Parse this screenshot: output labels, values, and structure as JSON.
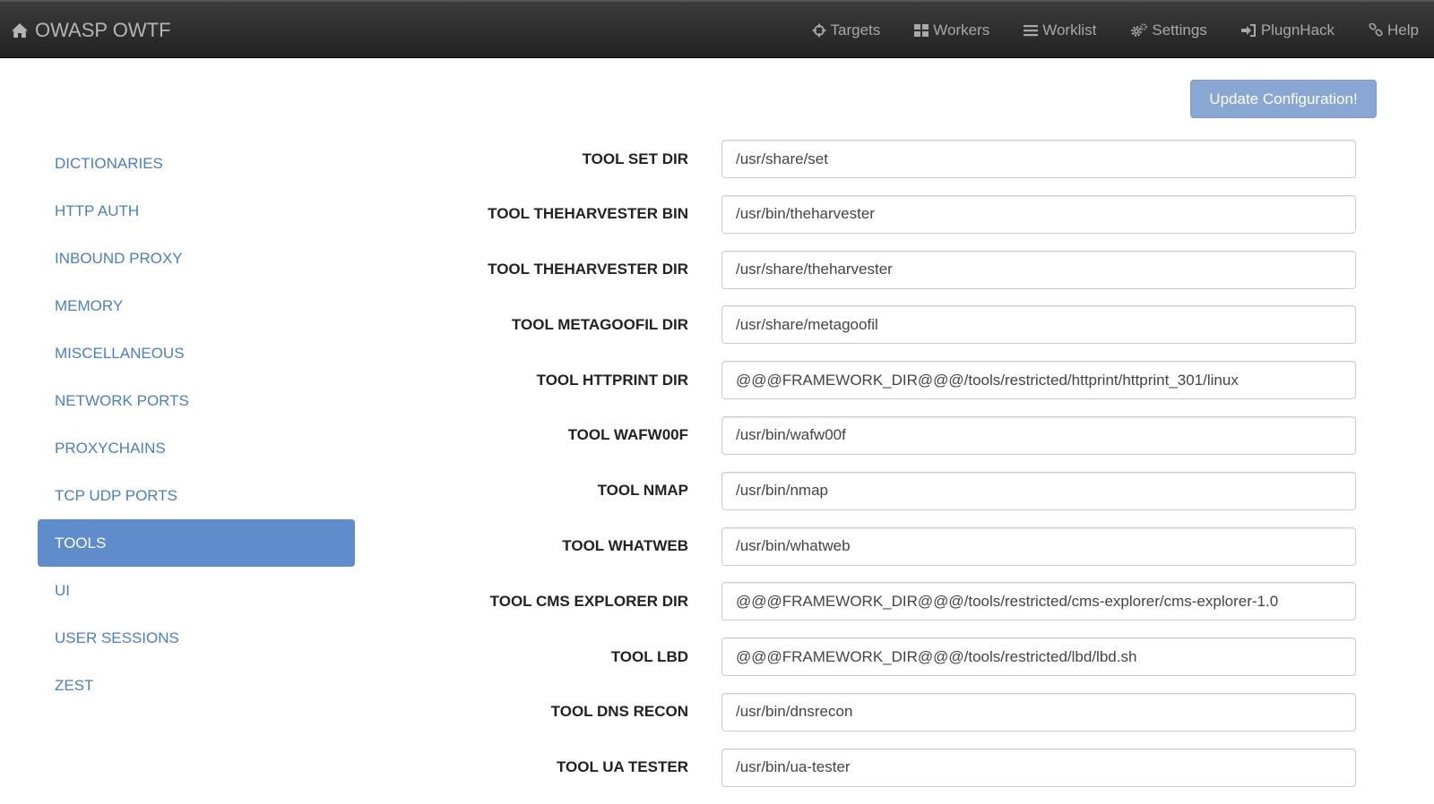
{
  "navbar": {
    "brand": "OWASP OWTF",
    "items": [
      {
        "label": "Targets",
        "icon": "crosshair-icon"
      },
      {
        "label": "Workers",
        "icon": "grid-icon"
      },
      {
        "label": "Worklist",
        "icon": "list-icon"
      },
      {
        "label": "Settings",
        "icon": "cogs-icon"
      },
      {
        "label": "PlugnHack",
        "icon": "sign-in-icon"
      },
      {
        "label": "Help",
        "icon": "link-icon"
      }
    ]
  },
  "update_button": "Update Configuration!",
  "sidebar": {
    "items": [
      {
        "label": "DICTIONARIES"
      },
      {
        "label": "HTTP AUTH"
      },
      {
        "label": "INBOUND PROXY"
      },
      {
        "label": "MEMORY"
      },
      {
        "label": "MISCELLANEOUS"
      },
      {
        "label": "NETWORK PORTS"
      },
      {
        "label": "PROXYCHAINS"
      },
      {
        "label": "TCP UDP PORTS"
      },
      {
        "label": "TOOLS",
        "active": true
      },
      {
        "label": "UI"
      },
      {
        "label": "USER SESSIONS"
      },
      {
        "label": "ZEST"
      }
    ]
  },
  "fields": [
    {
      "label": "TOOL SET DIR",
      "value": "/usr/share/set"
    },
    {
      "label": "TOOL THEHARVESTER BIN",
      "value": "/usr/bin/theharvester"
    },
    {
      "label": "TOOL THEHARVESTER DIR",
      "value": "/usr/share/theharvester"
    },
    {
      "label": "TOOL METAGOOFIL DIR",
      "value": "/usr/share/metagoofil"
    },
    {
      "label": "TOOL HTTPRINT DIR",
      "value": "@@@FRAMEWORK_DIR@@@/tools/restricted/httprint/httprint_301/linux"
    },
    {
      "label": "TOOL WAFW00F",
      "value": "/usr/bin/wafw00f"
    },
    {
      "label": "TOOL NMAP",
      "value": "/usr/bin/nmap"
    },
    {
      "label": "TOOL WHATWEB",
      "value": "/usr/bin/whatweb"
    },
    {
      "label": "TOOL CMS EXPLORER DIR",
      "value": "@@@FRAMEWORK_DIR@@@/tools/restricted/cms-explorer/cms-explorer-1.0"
    },
    {
      "label": "TOOL LBD",
      "value": "@@@FRAMEWORK_DIR@@@/tools/restricted/lbd/lbd.sh"
    },
    {
      "label": "TOOL DNS RECON",
      "value": "/usr/bin/dnsrecon"
    },
    {
      "label": "TOOL UA TESTER",
      "value": "/usr/bin/ua-tester"
    }
  ]
}
